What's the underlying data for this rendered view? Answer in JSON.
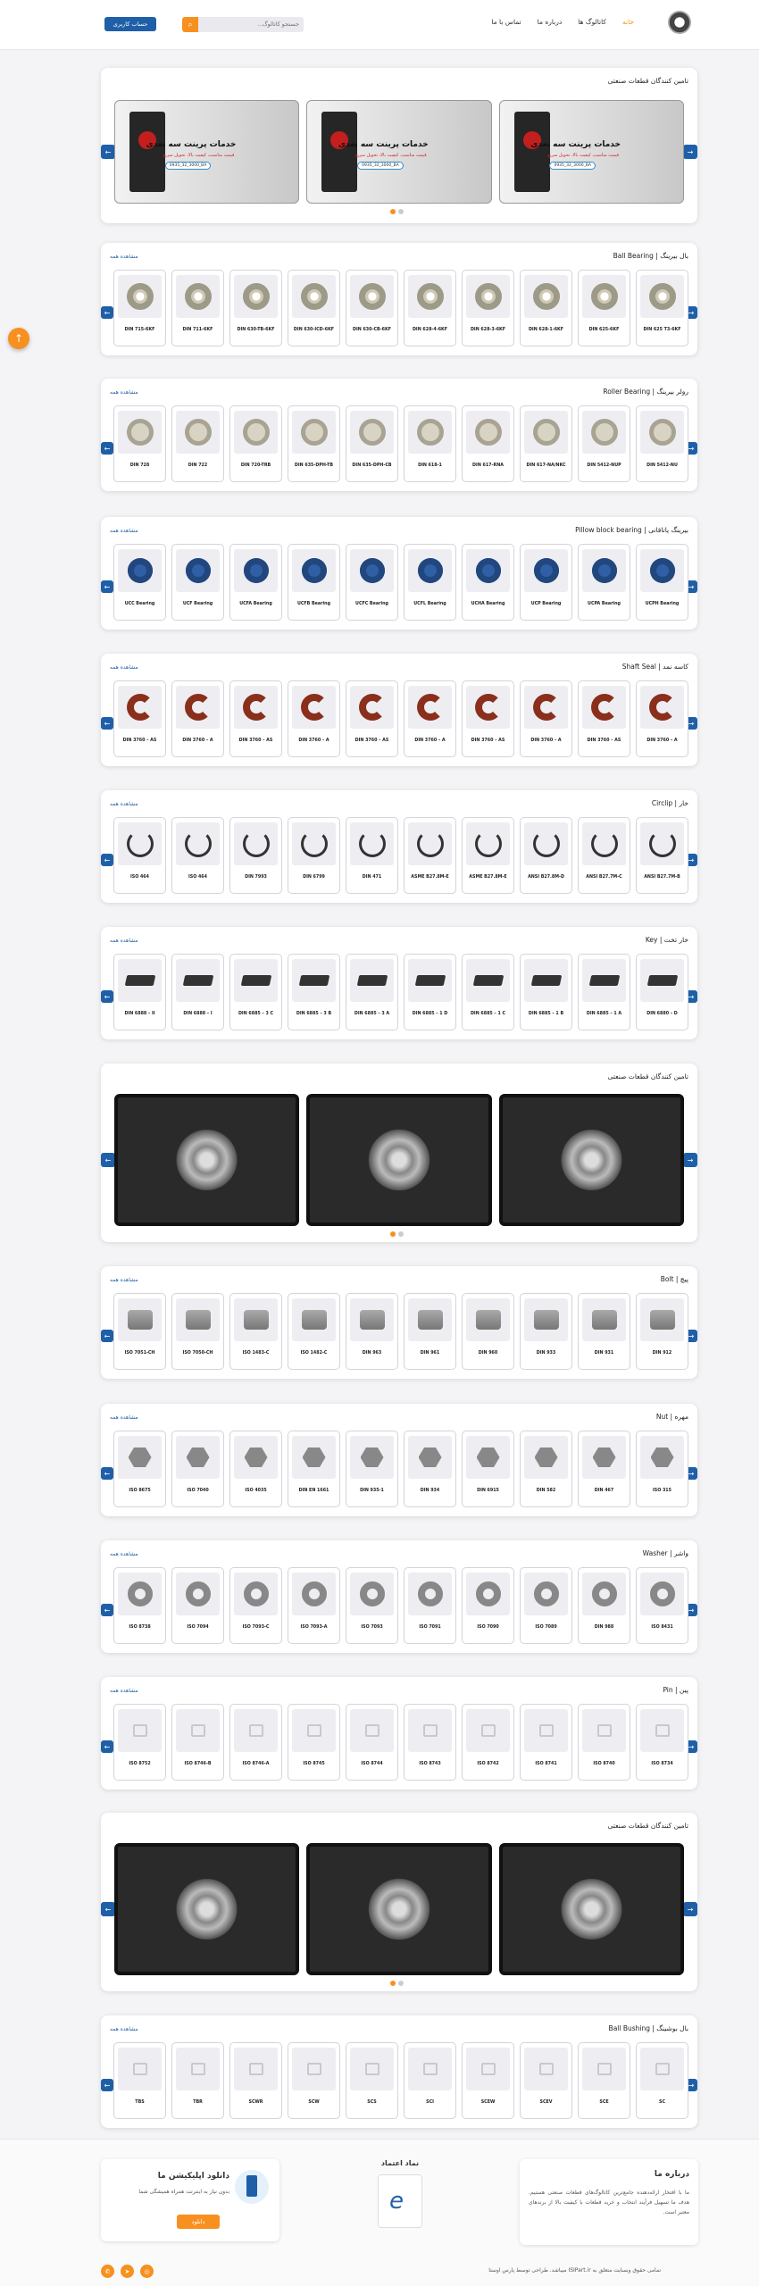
{
  "header": {
    "nav": [
      {
        "label": "خانه",
        "active": true
      },
      {
        "label": "کاتالوگ ها",
        "active": false
      },
      {
        "label": "درباره ما",
        "active": false
      },
      {
        "label": "تماس با ما",
        "active": false
      }
    ],
    "search_placeholder": "جستجو کاتالوگ...",
    "account_label": "حساب کاربری"
  },
  "colors": {
    "accent": "#f7901e",
    "primary": "#1f5fa8"
  },
  "banner1": {
    "title": "تامین کنندگان قطعات صنعتی",
    "slide_title": "خدمات پرینت سه بعدی",
    "slide_sub": "قیمت مناسب، کیفیت بالا، تحویل سریع",
    "slide_phone": "0935_32_3000_BA"
  },
  "banner2": {
    "title": "تامین کنندگان قطعات صنعتی"
  },
  "banner3": {
    "title": "تامین کنندگان قطعات صنعتی"
  },
  "see_all": "مشاهده همه",
  "sections": [
    {
      "title": "بال بیرینگ | Ball Bearing",
      "shape": "ring",
      "items": [
        "DIN 625 T3-6KF",
        "DIN 625-6KF",
        "DIN 628-1-6KF",
        "DIN 628-3-6KF",
        "DIN 628-4-6KF",
        "DIN 630-CB-6KF",
        "DIN 630-ICD-6KF",
        "DIN 630-TB-6KF",
        "DIN 711-6KF",
        "DIN 715-6KF"
      ]
    },
    {
      "title": "رولر بیرینگ | Roller Bearing",
      "shape": "roller",
      "items": [
        "DIN 5412-NU",
        "DIN 5412-NUP",
        "DIN 617-NA/NKC",
        "DIN 617-RNA",
        "DIN 618-1",
        "DIN 635-DPH-CB",
        "DIN 635-DPH-TB",
        "DIN 720-TRB",
        "DIN 722",
        "DIN 728"
      ]
    },
    {
      "title": "بیرینگ یاتاقانی | Pillow block bearing",
      "shape": "block",
      "items": [
        "UCPH Bearing",
        "UCPA Bearing",
        "UCP Bearing",
        "UCHA Bearing",
        "UCFL Bearing",
        "UCFC Bearing",
        "UCFB Bearing",
        "UCFA Bearing",
        "UCF Bearing",
        "UCC Bearing"
      ]
    },
    {
      "title": "کاسه نمد | Shaft Seal",
      "shape": "seal",
      "items": [
        "DIN 3760 – A",
        "DIN 3760 – AS",
        "DIN 3760 – A",
        "DIN 3760 – AS",
        "DIN 3760 – A",
        "DIN 3760 – AS",
        "DIN 3760 – A",
        "DIN 3760 – AS",
        "DIN 3760 – A",
        "DIN 3760 – AS"
      ]
    },
    {
      "title": "خار | Circlip",
      "shape": "clip",
      "items": [
        "ANSI B27.7M-B",
        "ANSI B27.7M-C",
        "ANSI B27.8M-D",
        "ASME B27.8M-E",
        "ASME B27.8M-E",
        "DIN 471",
        "DIN 6799",
        "DIN 7993",
        "ISO 464",
        "ISO 464"
      ]
    },
    {
      "title": "خار تخت | Key",
      "shape": "key",
      "items": [
        "DIN 6880 – D",
        "DIN 6885 – 1 A",
        "DIN 6885 – 1 B",
        "DIN 6885 – 1 C",
        "DIN 6885 – 1 D",
        "DIN 6885 – 3 A",
        "DIN 6885 – 3 B",
        "DIN 6885 – 3 C",
        "DIN 6888 – I",
        "DIN 6888 – II"
      ]
    },
    {
      "title": "پیچ | Bolt",
      "shape": "bolt",
      "items": [
        "DIN 912",
        "DIN 931",
        "DIN 933",
        "DIN 960",
        "DIN 961",
        "DIN 963",
        "ISO 1482-C",
        "ISO 1483-C",
        "ISO 7050-CH",
        "ISO 7051-CH"
      ]
    },
    {
      "title": "مهره | Nut",
      "shape": "nut",
      "items": [
        "ISO 315",
        "DIN 467",
        "DIN 582",
        "DIN 6915",
        "DIN 934",
        "DIN 935-1",
        "DIN EN 1661",
        "ISO 4035",
        "ISO 7040",
        "ISO 8675"
      ]
    },
    {
      "title": "واشر | Washer",
      "shape": "washer",
      "items": [
        "ISO 8431",
        "DIN 988",
        "ISO 7089",
        "ISO 7090",
        "ISO 7091",
        "ISO 7093",
        "ISO 7093-A",
        "ISO 7093-C",
        "ISO 7094",
        "ISO 8738"
      ]
    },
    {
      "title": "پین | Pin",
      "shape": "noimg",
      "items": [
        "ISO 8734",
        "ISO 8740",
        "ISO 8741",
        "ISO 8742",
        "ISO 8743",
        "ISO 8744",
        "ISO 8745",
        "ISO 8746-A",
        "ISO 8746-B",
        "ISO 8752"
      ]
    },
    {
      "title": "بال بوشینگ | Ball Bushing",
      "shape": "noimg",
      "items": [
        "SC",
        "SCE",
        "SCEV",
        "SCEW",
        "SCI",
        "SCS",
        "SCW",
        "SCWR",
        "TBR",
        "TBS"
      ]
    }
  ],
  "footer": {
    "about_title": "درباره ما",
    "about_text": "ما با افتخار ارائه‌دهنده جامع‌ترین کاتالوگ‌های قطعات صنعتی هستیم. هدف ما تسهیل فرآیند انتخاب و خرید قطعات با کیفیت بالا از برندهای معتبر است.",
    "trust_title": "نماد اعتماد",
    "app_title": "دانلود اپلیکیشن ما",
    "app_text": "بدون نیاز به اینترنت همراه همیشگی شما",
    "app_button": "دانلود",
    "copyright": "تمامی حقوق وبسایت متعلق به ISIPart.ir میباشد. طراحی توسط پارس اوستا"
  }
}
